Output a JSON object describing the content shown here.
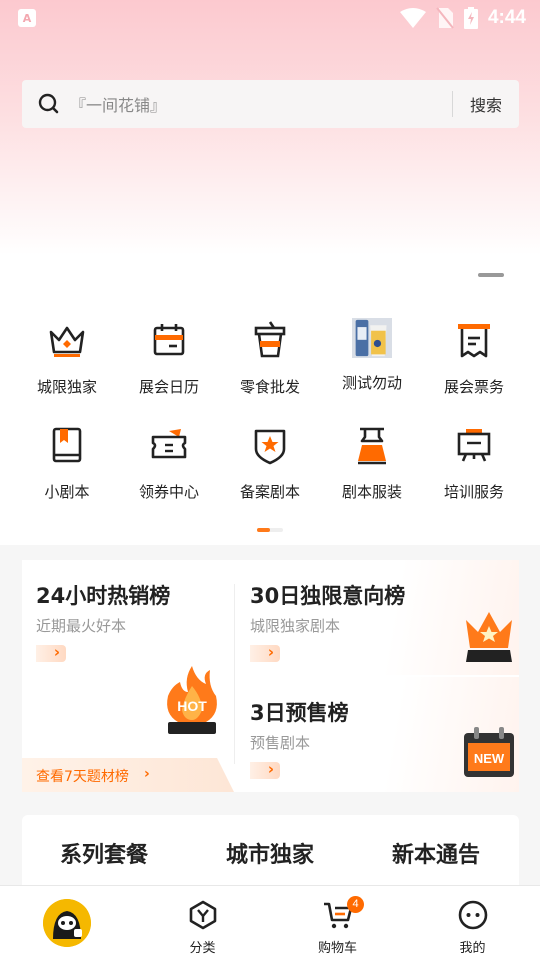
{
  "status_bar": {
    "time": "4:44",
    "app_icon_letter": "A"
  },
  "search": {
    "placeholder": "『一间花铺』",
    "button": "搜索"
  },
  "categories": [
    {
      "label": "城限独家",
      "icon": "crown-icon"
    },
    {
      "label": "展会日历",
      "icon": "calendar-icon"
    },
    {
      "label": "零食批发",
      "icon": "cup-icon"
    },
    {
      "label": "测试勿动",
      "icon": "beer-photo"
    },
    {
      "label": "展会票务",
      "icon": "ticket-icon"
    },
    {
      "label": "小剧本",
      "icon": "book-icon"
    },
    {
      "label": "领券中心",
      "icon": "coupon-icon"
    },
    {
      "label": "备案剧本",
      "icon": "shield-star-icon"
    },
    {
      "label": "剧本服装",
      "icon": "dress-icon"
    },
    {
      "label": "培训服务",
      "icon": "board-icon"
    }
  ],
  "rankings": {
    "hot24": {
      "title": "24小时热销榜",
      "subtitle": "近期最火好本",
      "footer": "查看7天题材榜",
      "badge": "HOT"
    },
    "exclusive30": {
      "title": "30日独限意向榜",
      "subtitle": "城限独家剧本"
    },
    "presale3": {
      "title": "3日预售榜",
      "subtitle": "预售剧本",
      "badge": "NEW"
    }
  },
  "tabs": [
    "系列套餐",
    "城市独家",
    "新本通告"
  ],
  "bottom_nav": {
    "items": [
      {
        "label": "",
        "icon": "avatar-home-icon"
      },
      {
        "label": "分类",
        "icon": "category-icon"
      },
      {
        "label": "购物车",
        "icon": "cart-icon"
      },
      {
        "label": "我的",
        "icon": "profile-icon"
      }
    ],
    "cart_count": "4"
  },
  "colors": {
    "accent": "#ff6a00",
    "tab_underline": "#7a3a14",
    "hero_top": "#fcc9cf"
  }
}
